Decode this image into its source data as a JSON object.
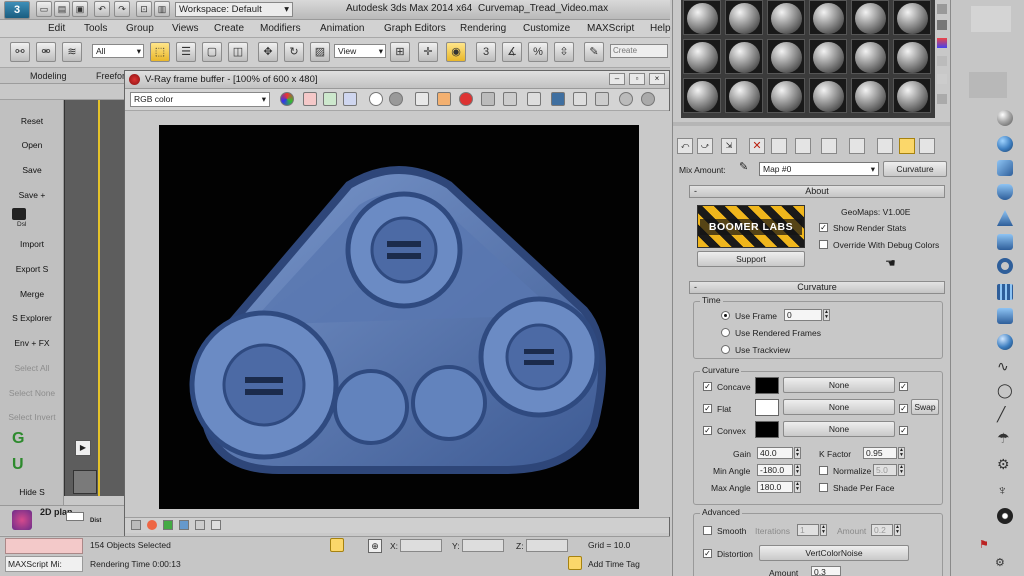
{
  "app": {
    "title": "Autodesk 3ds Max  2014 x64",
    "file_name": "Curvemap_Tread_Video.max",
    "workspace_label": "Workspace: Default"
  },
  "menu": [
    "Edit",
    "Tools",
    "Group",
    "Views",
    "Create",
    "Modifiers",
    "Animation",
    "Graph Editors",
    "Rendering",
    "Customize",
    "MAXScript",
    "Help"
  ],
  "toolbar": {
    "selection_filter": "All",
    "reference_coord": "View",
    "named_selection_placeholder": "Create Selection Se"
  },
  "ribbon_tabs": [
    "Modeling",
    "Freeform"
  ],
  "left_panel": {
    "items": [
      {
        "label": "Reset",
        "enabled": true
      },
      {
        "label": "Open",
        "enabled": true
      },
      {
        "label": "Save",
        "enabled": true
      },
      {
        "label": "Save +",
        "enabled": true
      },
      {
        "label": "Dsl",
        "enabled": true
      },
      {
        "label": "Import",
        "enabled": true
      },
      {
        "label": "Export S",
        "enabled": true
      },
      {
        "label": "Merge",
        "enabled": true
      },
      {
        "label": "S Explorer",
        "enabled": true
      },
      {
        "label": "Env + FX",
        "enabled": true
      },
      {
        "label": "Select All",
        "enabled": false
      },
      {
        "label": "Select None",
        "enabled": false
      },
      {
        "label": "Select Invert",
        "enabled": false
      },
      {
        "label": "G",
        "enabled": true
      },
      {
        "label": "U",
        "enabled": true
      },
      {
        "label": "Hide S",
        "enabled": true
      }
    ],
    "bottom_labels": [
      "2D plan",
      "Dist"
    ]
  },
  "vfb": {
    "title": "V-Ray frame buffer - [100% of 600 x 480]",
    "channel": "RGB color"
  },
  "status": {
    "selected": "154 Objects Selected",
    "rendering_time": "Rendering Time  0:00:13",
    "x_label": "X:",
    "y_label": "Y:",
    "z_label": "Z:",
    "grid": "Grid = 10.0",
    "add_time_tag": "Add Time Tag",
    "maxscript": "MAXScript Mi:"
  },
  "material": {
    "mix_amount_label": "Mix Amount:",
    "map_name": "Map #0",
    "map_type": "Curvature"
  },
  "about": {
    "header": "About",
    "logo_text": "BOOMER LABS",
    "version": "GeoMaps: V1.00E",
    "show_render_stats": "Show Render Stats",
    "override_debug": "Override With Debug Colors",
    "support_button": "Support",
    "header_sign": "-"
  },
  "curvature": {
    "header": "Curvature",
    "header_sign": "-",
    "time_group": "Time",
    "use_frame": "Use Frame",
    "frame_value": "0",
    "use_rendered_frames": "Use Rendered Frames",
    "use_trackview": "Use Trackview",
    "curvature_group": "Curvature",
    "concave": "Concave",
    "flat": "Flat",
    "convex": "Convex",
    "none": "None",
    "swap": "Swap",
    "gain_label": "Gain",
    "gain_value": "40.0",
    "kfactor_label": "K Factor",
    "kfactor_value": "0.95",
    "min_angle_label": "Min Angle",
    "min_angle_value": "-180.0",
    "normalize_label": "Normalize",
    "normalize_value": "5.0",
    "max_angle_label": "Max Angle",
    "max_angle_value": "180.0",
    "shade_per_face": "Shade Per Face",
    "advanced_group": "Advanced",
    "smooth": "Smooth",
    "iterations_label": "Iterations",
    "iterations_value": "1",
    "amount_label": "Amount",
    "amount_value": "0.2",
    "distortion": "Distortion",
    "distortion_map": "VertColorNoise",
    "amount2_value": "0.3"
  },
  "colors": {
    "concave_swatch": "#000000",
    "flat_swatch": "#ffffff",
    "convex_swatch": "#000000",
    "render_bg": "#020202",
    "tread_blue": "#5b7bb4"
  }
}
